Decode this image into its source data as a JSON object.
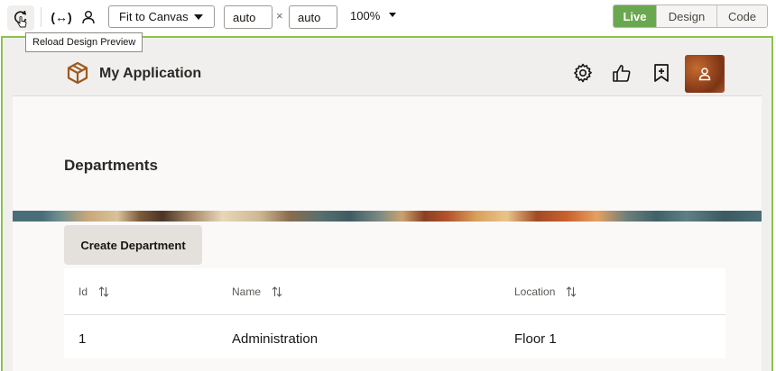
{
  "toolbar": {
    "fit_select": "Fit to Canvas",
    "width_value": "auto",
    "height_value": "auto",
    "times_symbol": "×",
    "zoom": "100%",
    "modes": [
      "Live",
      "Design",
      "Code"
    ],
    "active_mode": "Live",
    "tooltip": "Reload Design Preview",
    "variables_glyph": "(↔)"
  },
  "app": {
    "title": "My Application",
    "page_heading": "Departments",
    "create_button": "Create Department",
    "table": {
      "columns": [
        "Id",
        "Name",
        "Location"
      ],
      "rows": [
        [
          "1",
          "Administration",
          "Floor 1"
        ]
      ]
    }
  },
  "colors": {
    "live_green": "#6aa84f",
    "canvas_border": "#8bc34a",
    "header_bg": "#f1efed",
    "logo_brown": "#9c5a1f"
  },
  "icons": [
    "reload-icon",
    "variables-icon",
    "user-icon",
    "box-logo-icon",
    "gear-icon",
    "thumbs-up-icon",
    "bookmark-add-icon",
    "avatar-user-icon",
    "sort-icon"
  ]
}
